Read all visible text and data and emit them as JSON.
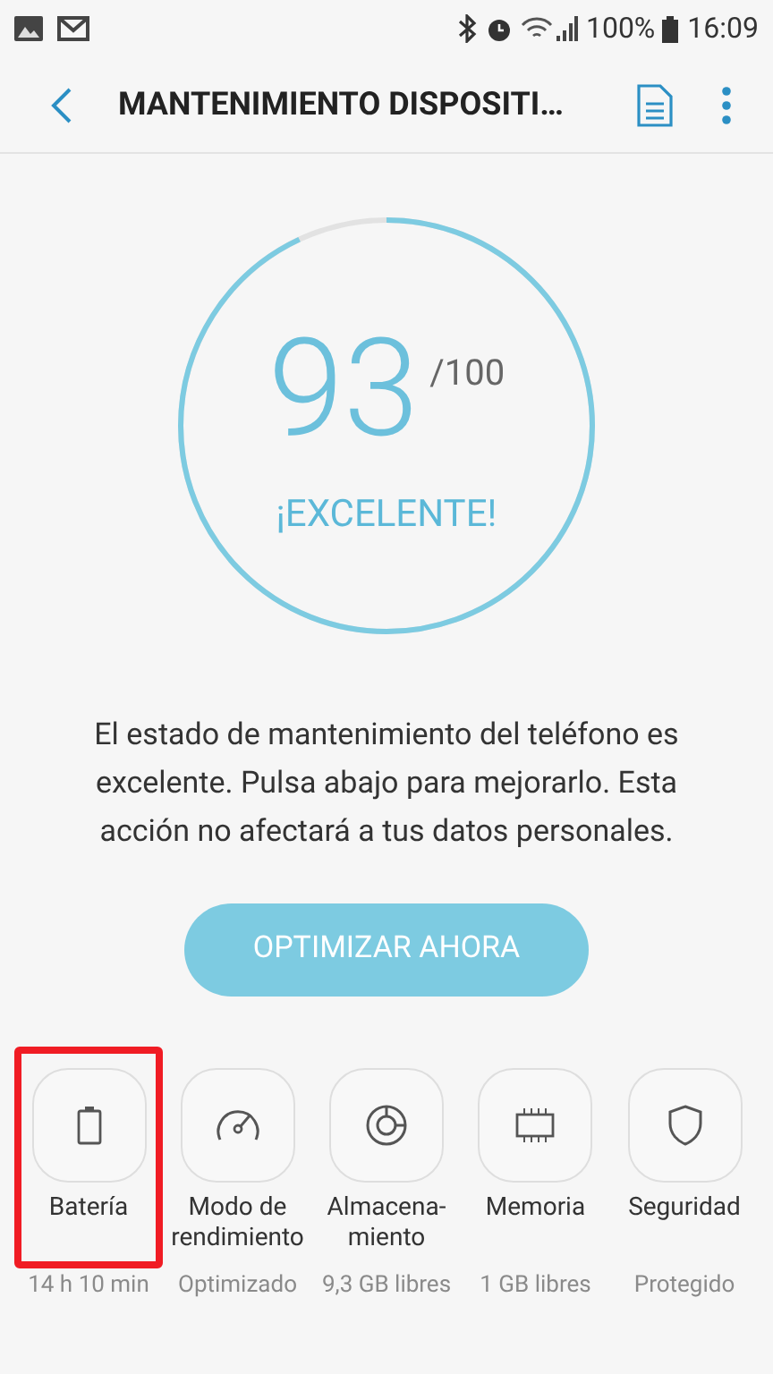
{
  "status_bar": {
    "battery": "100%",
    "time": "16:09"
  },
  "header": {
    "title": "MANTENIMIENTO DISPOSITI…"
  },
  "score": {
    "value": "93",
    "max": "/100",
    "rating": "¡EXCELENTE!",
    "level": 0.93
  },
  "message": "El estado de mantenimiento del teléfono es excelente. Pulsa abajo para mejorarlo. Esta acción no afectará a tus datos personales.",
  "button": "OPTIMIZAR AHORA",
  "items": [
    {
      "kind": "battery",
      "label": "Batería",
      "detail": "14 h 10 min",
      "highlighted": true
    },
    {
      "kind": "performance",
      "label": "Modo de rendimiento",
      "detail": "Optimizado",
      "highlighted": false
    },
    {
      "kind": "storage",
      "label": "Almacena-miento",
      "detail": "9,3 GB libres",
      "highlighted": false
    },
    {
      "kind": "memory",
      "label": "Memoria",
      "detail": "1 GB libres",
      "highlighted": false
    },
    {
      "kind": "security",
      "label": "Seguridad",
      "detail": "Protegido",
      "highlighted": false
    }
  ]
}
